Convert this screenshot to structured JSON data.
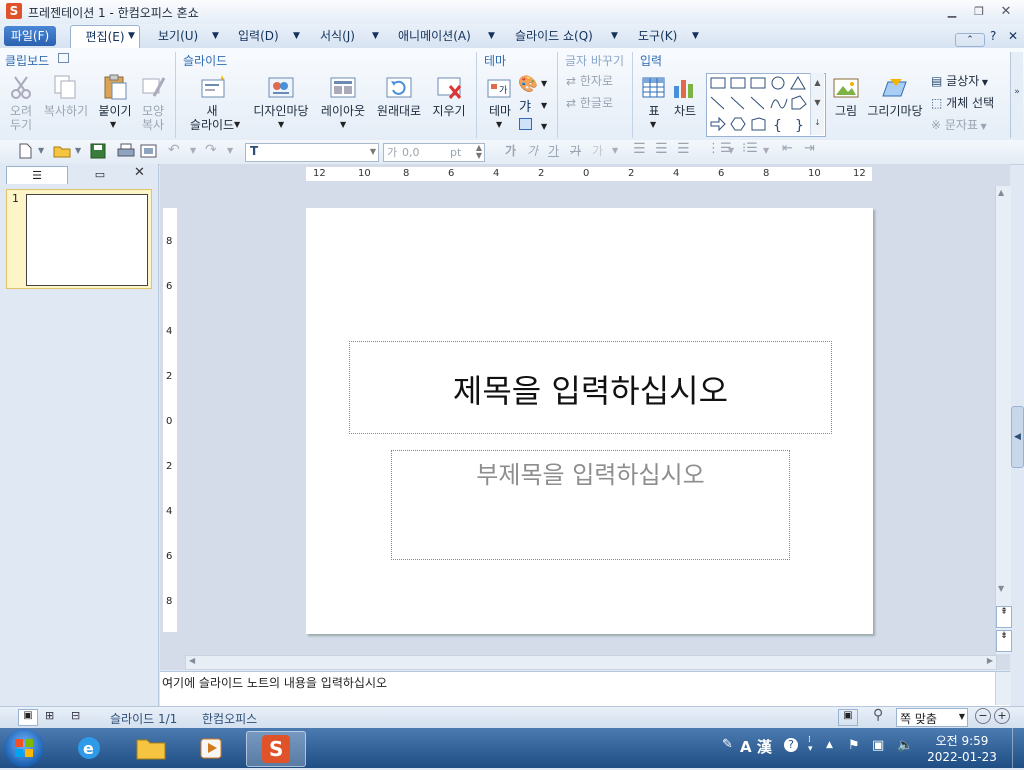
{
  "window": {
    "app_icon_letter": "S",
    "title": "프레젠테이션 1 - 한컴오피스 혼쇼",
    "controls": [
      "minimize",
      "restore",
      "close"
    ]
  },
  "menubar": {
    "file": "파일(F)",
    "edit": "편집(E)",
    "items": [
      "보기(U)",
      "입력(D)",
      "서식(J)",
      "애니메이션(A)",
      "슬라이드 쇼(Q)",
      "도구(K)"
    ],
    "help": "?"
  },
  "ribbon": {
    "groups": {
      "clipboard": "클립보드",
      "slide": "슬라이드",
      "theme": "테마",
      "change_text": "글자 바꾸기",
      "insert": "입력"
    },
    "clipboard": {
      "cut": [
        "오려",
        "두기"
      ],
      "copy": "복사하기",
      "paste": "붙이기",
      "format_copy": [
        "모양",
        "복사"
      ]
    },
    "slide": {
      "new_slide": [
        "새",
        "슬라이드"
      ],
      "design": "디자인마당",
      "layout": "레이아웃",
      "reset": "원래대로",
      "delete": "지우기"
    },
    "theme": {
      "theme": "테마"
    },
    "change_text": {
      "to_hanja": "한자로",
      "to_hangul": "한글로"
    },
    "insert": {
      "table": "표",
      "chart": "차트",
      "picture": "그림",
      "drawing": "그리기마당",
      "textbox": "글상자",
      "object_select": "개체 선택",
      "textart": "문자표"
    }
  },
  "toolbar": {
    "font_icon": "T",
    "size_label": "가",
    "size_value": "0,0",
    "size_unit": "pt",
    "char_buttons": [
      "가",
      "가",
      "가",
      "가",
      "가"
    ]
  },
  "ruler": {
    "h_ticks": [
      "12",
      "10",
      "8",
      "6",
      "4",
      "2",
      "0",
      "2",
      "4",
      "6",
      "8",
      "10",
      "12"
    ],
    "v_ticks": [
      "8",
      "6",
      "4",
      "2",
      "0",
      "2",
      "4",
      "6",
      "8"
    ]
  },
  "slides_panel": {
    "slide_number": "1"
  },
  "slide": {
    "title_placeholder": "제목을 입력하십시오",
    "subtitle_placeholder": "부제목을 입력하십시오"
  },
  "notes": {
    "placeholder": "여기에 슬라이드 노트의 내용을 입력하십시오"
  },
  "statusbar": {
    "slide_info": "슬라이드 1/1",
    "app_name": "한컴오피스",
    "zoom": "쪽 맞춤"
  },
  "taskbar": {
    "ime": "A 漢",
    "time": "오전 9:59",
    "date": "2022-01-23"
  },
  "colors": {
    "accent": "#2f6bb4",
    "file_menu": "#2b62b0",
    "taskbar": "#1f4e84"
  }
}
